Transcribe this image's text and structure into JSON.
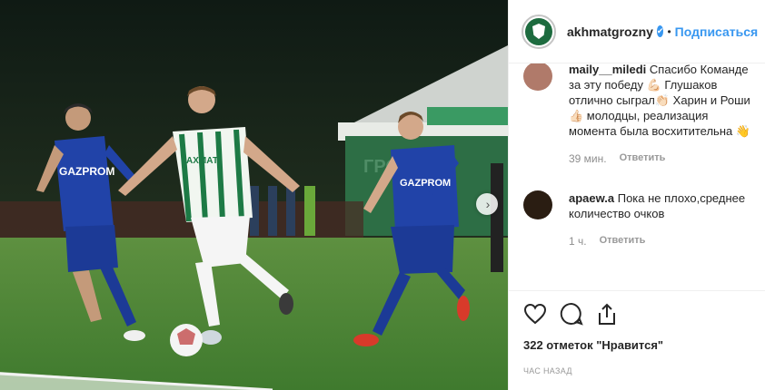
{
  "photo": {
    "alt_icon": "football-match-photo",
    "next_icon": "chevron-right-icon"
  },
  "header": {
    "username": "akhmatgrozny",
    "verified_icon": "verified-badge-icon",
    "separator": "•",
    "follow_label": "Подписаться"
  },
  "comments": [
    {
      "user": "maily__miledi",
      "text": "Спасибо Команде за эту победу 💪🏻 Глушаков отлично сыграл👏🏻 Харин и Роши 👍🏻 молодцы, реализация момента была восхитительна 👋",
      "time": "39 мин.",
      "reply": "Ответить",
      "avatar_color": "#b07a6a"
    },
    {
      "user": "apaew.a",
      "text": "Пока не плохо,среднее количество очков",
      "time": "1 ч.",
      "reply": "Ответить",
      "avatar_color": "#2a1d12"
    }
  ],
  "actions": {
    "icons": [
      "heart-icon",
      "comment-icon",
      "share-icon"
    ],
    "likes": "322 отметок \"Нравится\"",
    "timestamp": "ЧАС НАЗАД"
  },
  "colors": {
    "accent": "#3897f0",
    "kit_blue": "#2143a8",
    "kit_green": "#1d7a45",
    "pitch": "#4f8a3a"
  }
}
